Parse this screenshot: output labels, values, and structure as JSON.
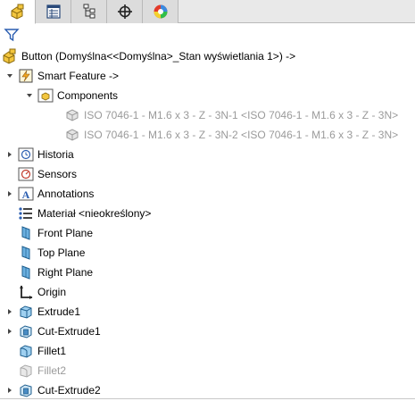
{
  "tabs": [
    {
      "name": "featuremanager-tab",
      "icon": "part-tree-icon"
    },
    {
      "name": "propertymanager-tab",
      "icon": "property-list-icon"
    },
    {
      "name": "configurationmanager-tab",
      "icon": "configuration-icon"
    },
    {
      "name": "dimxpert-tab",
      "icon": "crosshair-icon"
    },
    {
      "name": "displaymanager-tab",
      "icon": "appearance-sphere-icon"
    }
  ],
  "tree": {
    "root": {
      "label": "Button  (Domyślna<<Domyślna>_Stan wyświetlania 1>) ->"
    },
    "smart_feature": {
      "label": "Smart Feature ->"
    },
    "components": {
      "label": "Components"
    },
    "iso1": {
      "label": "ISO 7046-1 - M1.6 x 3 - Z - 3N-1  <ISO 7046-1 - M1.6 x 3 - Z - 3N>"
    },
    "iso2": {
      "label": "ISO 7046-1 - M1.6 x 3 - Z - 3N-2  <ISO 7046-1 - M1.6 x 3 - Z - 3N>"
    },
    "historia": {
      "label": "Historia"
    },
    "sensors": {
      "label": "Sensors"
    },
    "annotations": {
      "label": "Annotations"
    },
    "material": {
      "label": "Materiał <nieokreślony>"
    },
    "front_plane": {
      "label": "Front Plane"
    },
    "top_plane": {
      "label": "Top Plane"
    },
    "right_plane": {
      "label": "Right Plane"
    },
    "origin": {
      "label": "Origin"
    },
    "extrude1": {
      "label": "Extrude1"
    },
    "cut_extrude1": {
      "label": "Cut-Extrude1"
    },
    "fillet1": {
      "label": "Fillet1"
    },
    "fillet2": {
      "label": "Fillet2"
    },
    "cut_extrude2": {
      "label": "Cut-Extrude2"
    }
  }
}
